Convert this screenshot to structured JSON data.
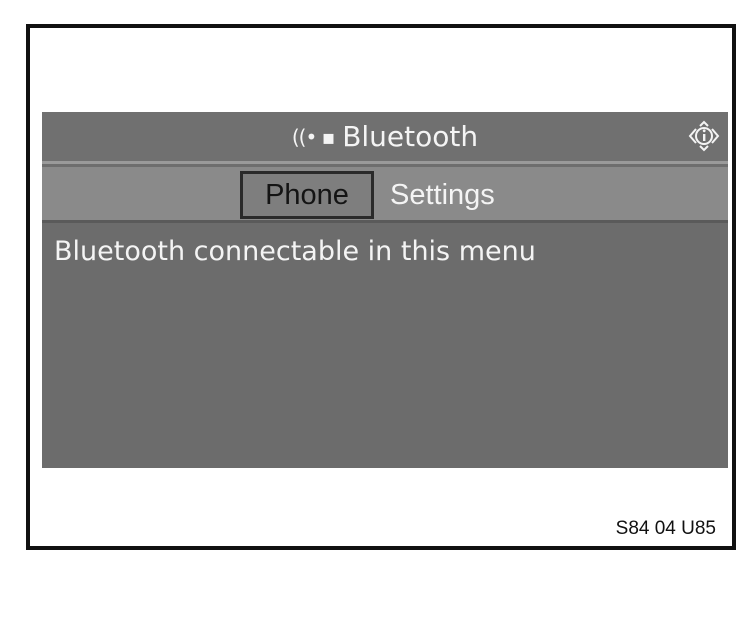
{
  "header": {
    "icon": "bluetooth-signal-icon",
    "icon_glyph": "((• ▪",
    "title": "Bluetooth",
    "info_icon": "info-scroll-icon"
  },
  "tabs": [
    {
      "label": "Phone",
      "selected": true
    },
    {
      "label": "Settings",
      "selected": false
    }
  ],
  "content": {
    "message": "Bluetooth connectable in this menu"
  },
  "figure": {
    "code": "S84 04 U85"
  },
  "colors": {
    "screen_background": "#6e6e6e",
    "tabbar_background": "#8a8a8a",
    "text_light": "#f4f4f4",
    "selected_tab_border": "#2a2a2a",
    "frame_border": "#111111"
  }
}
